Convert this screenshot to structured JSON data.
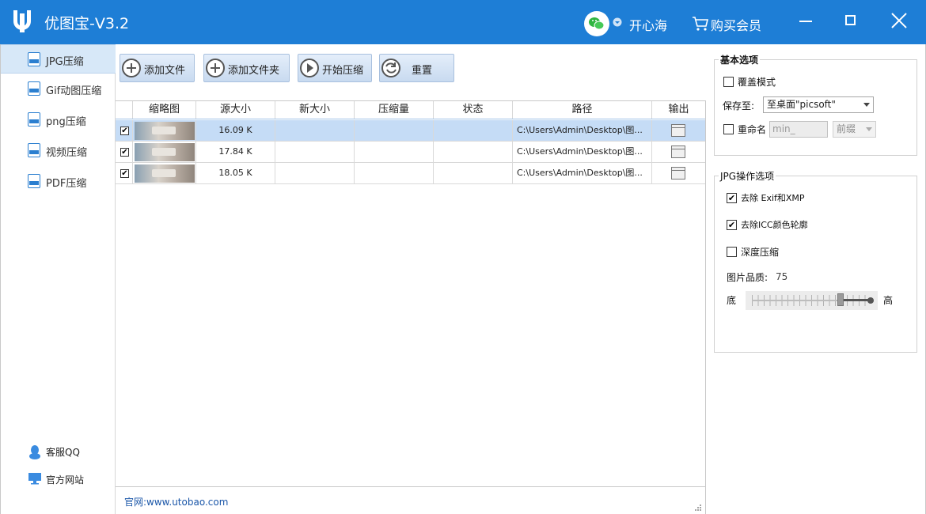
{
  "app": {
    "title": "优图宝-V3.2",
    "user": "开心海",
    "buy_label": "购买会员"
  },
  "sidebar": {
    "items": [
      {
        "label": "JPG压缩",
        "active": true
      },
      {
        "label": "Gif动图压缩"
      },
      {
        "label": "png压缩"
      },
      {
        "label": "视频压缩"
      },
      {
        "label": "PDF压缩"
      }
    ],
    "bottom": [
      {
        "label": "客服QQ"
      },
      {
        "label": "官方网站"
      }
    ]
  },
  "toolbar": {
    "add_file": "添加文件",
    "add_folder": "添加文件夹",
    "start": "开始压缩",
    "reset": "重置"
  },
  "table": {
    "columns": [
      "缩略图",
      "源大小",
      "新大小",
      "压缩量",
      "状态",
      "路径",
      "输出"
    ],
    "rows": [
      {
        "checked": "✔",
        "src_size": "16.09 K",
        "new_size": "",
        "reduction": "",
        "status": "",
        "path": "C:\\Users\\Admin\\Desktop\\图..."
      },
      {
        "checked": "✔",
        "src_size": "17.84 K",
        "new_size": "",
        "reduction": "",
        "status": "",
        "path": "C:\\Users\\Admin\\Desktop\\图..."
      },
      {
        "checked": "✔",
        "src_size": "18.05 K",
        "new_size": "",
        "reduction": "",
        "status": "",
        "path": "C:\\Users\\Admin\\Desktop\\图..."
      }
    ]
  },
  "footer": {
    "site": "官网:www.utobao.com"
  },
  "options": {
    "basic_title": "基本选项",
    "overwrite_label": "覆盖模式",
    "save_to_label": "保存至:",
    "save_to_value": "至桌面\"picsoft\"",
    "rename_label": "重命名",
    "rename_value": "min_",
    "prefix_value": "前缀",
    "jpg_title": "JPG操作选项",
    "remove_exif": "去除 Exif和XMP",
    "remove_icc": "去除ICC颜色轮廓",
    "deep_compress": "深度压缩",
    "quality_label": "图片品质:",
    "quality_value": "75",
    "low_label": "底",
    "high_label": "高",
    "check_mark": "✔"
  }
}
